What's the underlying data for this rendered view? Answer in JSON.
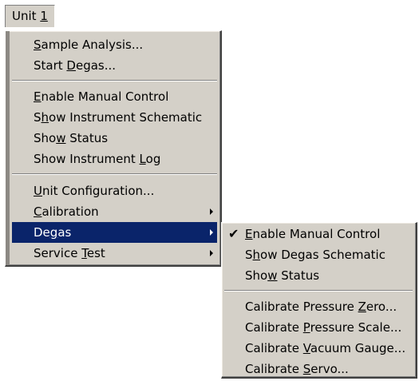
{
  "menubar": {
    "item": {
      "pre": "Unit ",
      "ul": "1",
      "post": ""
    }
  },
  "main_menu": {
    "items": [
      {
        "pre": "",
        "ul": "S",
        "post": "ample Analysis..."
      },
      {
        "pre": "Start ",
        "ul": "D",
        "post": "egas..."
      },
      {
        "pre": "",
        "ul": "E",
        "post": "nable Manual Control"
      },
      {
        "pre": "S",
        "ul": "h",
        "post": "ow Instrument Schematic"
      },
      {
        "pre": "Sho",
        "ul": "w",
        "post": " Status"
      },
      {
        "pre": "Show Instrument ",
        "ul": "L",
        "post": "og"
      },
      {
        "pre": "",
        "ul": "U",
        "post": "nit Configuration..."
      },
      {
        "pre": "",
        "ul": "C",
        "post": "alibration"
      },
      {
        "pre": "De",
        "ul": "g",
        "post": "as"
      },
      {
        "pre": "Service ",
        "ul": "T",
        "post": "est"
      }
    ]
  },
  "sub_menu": {
    "check_glyph": "✔",
    "items": [
      {
        "pre": "",
        "ul": "E",
        "post": "nable Manual Control"
      },
      {
        "pre": "S",
        "ul": "h",
        "post": "ow Degas Schematic"
      },
      {
        "pre": "Sho",
        "ul": "w",
        "post": " Status"
      },
      {
        "pre": "Calibrate Pressure ",
        "ul": "Z",
        "post": "ero..."
      },
      {
        "pre": "Calibrate ",
        "ul": "P",
        "post": "ressure Scale..."
      },
      {
        "pre": "Calibrate ",
        "ul": "V",
        "post": "acuum Gauge..."
      },
      {
        "pre": "Calibrate ",
        "ul": "S",
        "post": "ervo..."
      }
    ]
  },
  "colors": {
    "menu_bg": "#d4d0c8",
    "highlight_bg": "#0a246a",
    "highlight_text": "#ffffff",
    "text": "#000000"
  }
}
